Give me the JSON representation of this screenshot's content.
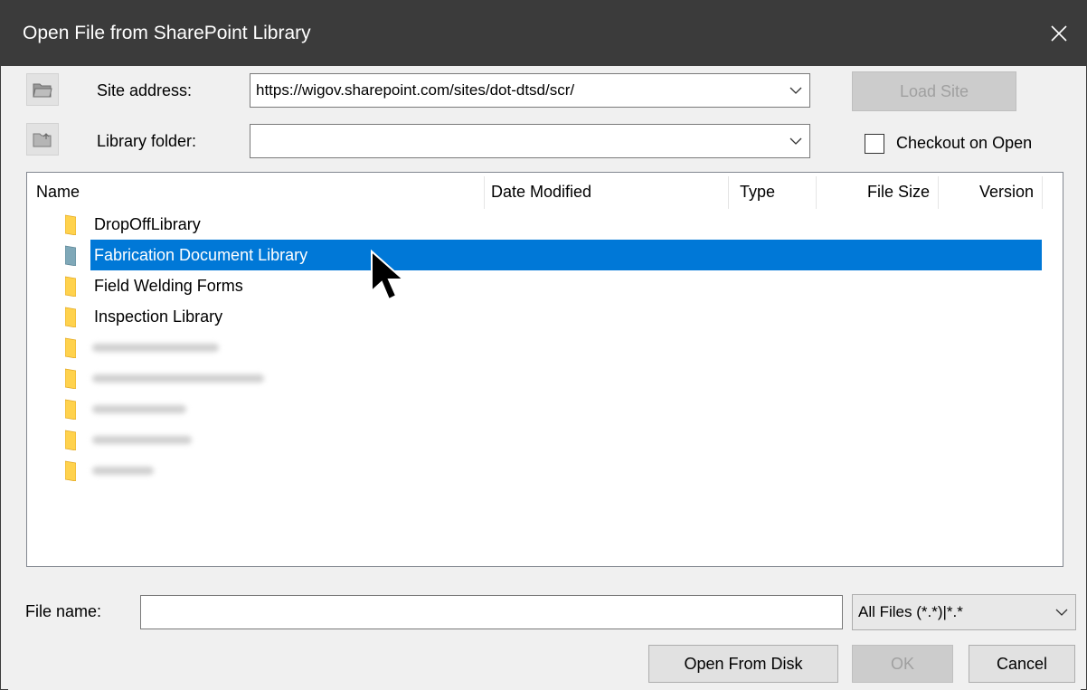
{
  "window": {
    "title": "Open File from SharePoint Library",
    "close_symbol": "✕"
  },
  "site": {
    "label": "Site address:",
    "value": "https://wigov.sharepoint.com/sites/dot-dtsd/scr/",
    "load_button": "Load Site",
    "icon": "folder-open-icon"
  },
  "library": {
    "label": "Library folder:",
    "value": "",
    "icon": "folder-up-icon"
  },
  "checkout": {
    "label": "Checkout on Open",
    "checked": false
  },
  "list": {
    "columns": [
      "Name",
      "Date Modified",
      "Type",
      "File Size",
      "Version"
    ],
    "items": [
      {
        "name": "DropOffLibrary",
        "selected": false
      },
      {
        "name": "Fabrication Document Library",
        "selected": true
      },
      {
        "name": "Field Welding Forms",
        "selected": false
      },
      {
        "name": "Inspection Library",
        "selected": false
      }
    ],
    "folder_color": "#ffd24d",
    "selected_color": "#0078d7"
  },
  "file": {
    "label": "File name:",
    "value": "",
    "filter": "All Files (*.*)|*.*"
  },
  "buttons": {
    "open_disk": "Open From Disk",
    "ok": "OK",
    "cancel": "Cancel"
  },
  "chevron": "⌵"
}
